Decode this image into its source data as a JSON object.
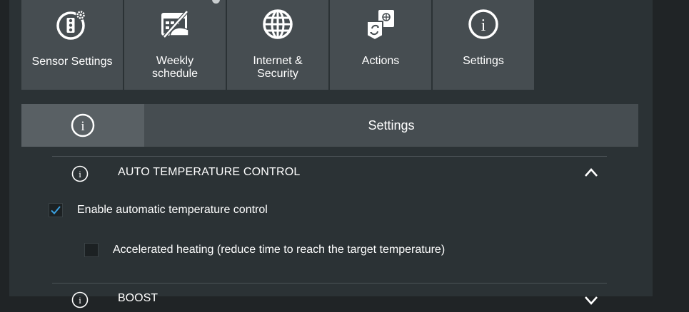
{
  "tiles": [
    {
      "label_line1": "Sensor Settings",
      "label_line2": "",
      "icon": "sensor-settings-icon"
    },
    {
      "label_line1": "Weekly",
      "label_line2": "schedule",
      "icon": "weekly-schedule-icon"
    },
    {
      "label_line1": "Internet &",
      "label_line2": "Security",
      "icon": "globe-icon"
    },
    {
      "label_line1": "Actions",
      "label_line2": "",
      "icon": "actions-icon"
    },
    {
      "label_line1": "Settings",
      "label_line2": "",
      "icon": "info-icon"
    }
  ],
  "tabbar": {
    "icon": "info-icon",
    "title": "Settings"
  },
  "section_auto": {
    "icon": "info-icon",
    "title": "AUTO TEMPERATURE CONTROL",
    "expanded": true,
    "toggle_icon": "chevron-up-icon"
  },
  "options": [
    {
      "label": "Enable automatic temperature control",
      "checked": true
    },
    {
      "label": "Accelerated heating (reduce time to reach the target temperature)",
      "checked": false
    }
  ],
  "section_boost": {
    "icon": "info-icon",
    "title": "BOOST",
    "expanded": false,
    "toggle_icon": "chevron-down-icon"
  },
  "colors": {
    "background": "#202426",
    "panel": "#2b3235",
    "tile": "#464d51",
    "tab_active": "#596064",
    "check_accent": "#3aa0e0"
  }
}
